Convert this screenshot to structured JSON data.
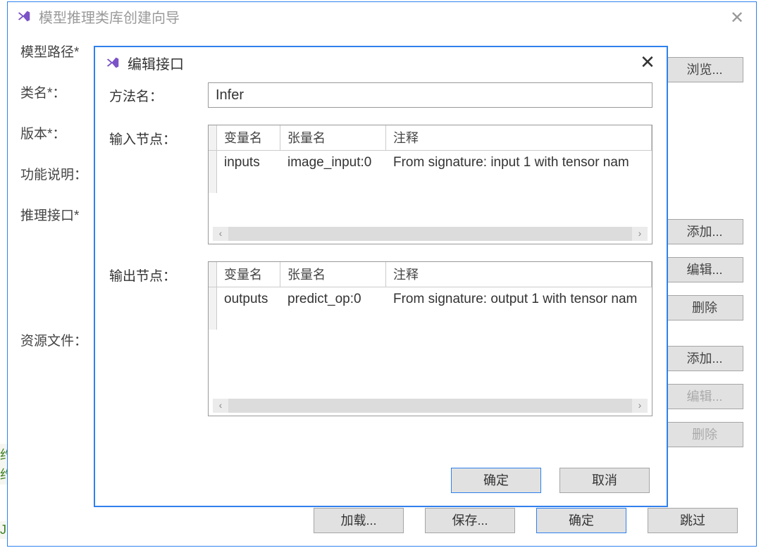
{
  "bgFrag1": "约",
  "bgFrag2": "约",
  "bgFrag3": "J",
  "parent": {
    "title": "模型推理类库创建向导",
    "labels": {
      "modelPath": "模型路径*",
      "className": "类名*：",
      "version": "版本*：",
      "description": "功能说明：",
      "inferInterface": "推理接口*",
      "resourceFile": "资源文件："
    },
    "buttons": {
      "browse": "浏览...",
      "add": "添加...",
      "edit": "编辑...",
      "delete": "删除",
      "add2": "添加...",
      "edit2": "编辑...",
      "delete2": "删除",
      "load": "加载...",
      "save": "保存...",
      "ok": "确定",
      "skip": "跳过"
    }
  },
  "modal": {
    "title": "编辑接口",
    "labels": {
      "methodName": "方法名：",
      "inputNodes": "输入节点：",
      "outputNodes": "输出节点："
    },
    "methodNameValue": "Infer",
    "columns": {
      "varName": "变量名",
      "tensorName": "张量名",
      "comment": "注释"
    },
    "inputRow": {
      "var": "inputs",
      "tensor": "image_input:0",
      "comment": "From signature: input 1 with tensor nam"
    },
    "outputRow": {
      "var": "outputs",
      "tensor": "predict_op:0",
      "comment": "From signature: output 1 with tensor nam"
    },
    "buttons": {
      "ok": "确定",
      "cancel": "取消"
    }
  }
}
